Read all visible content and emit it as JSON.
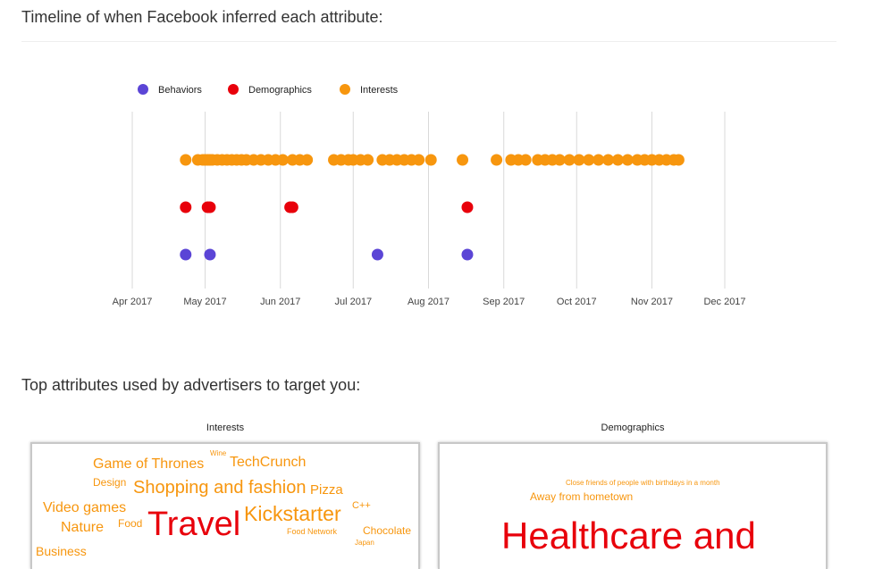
{
  "sections": {
    "timeline_title": "Timeline of when Facebook inferred each attribute:",
    "attributes_title": "Top attributes used by advertisers to target you:"
  },
  "colors": {
    "Behaviors": "#5b45d6",
    "Demographics": "#e8000b",
    "Interests": "#f7960e"
  },
  "chart_data": [
    {
      "type": "scatter",
      "xaxis": "date",
      "xlim": [
        "2017-03-14",
        "2017-12-24"
      ],
      "x_ticks": [
        "Apr 2017",
        "May 2017",
        "Jun 2017",
        "Jul 2017",
        "Aug 2017",
        "Sep 2017",
        "Oct 2017",
        "Nov 2017",
        "Dec 2017"
      ],
      "x_tick_dates": [
        "2017-04-01",
        "2017-05-01",
        "2017-06-01",
        "2017-07-01",
        "2017-08-01",
        "2017-09-01",
        "2017-10-01",
        "2017-11-01",
        "2017-12-01"
      ],
      "grid": "vertical",
      "legend_position": "top-left",
      "series": [
        {
          "name": "Behaviors",
          "dates": [
            "2017-04-23",
            "2017-05-03",
            "2017-07-11",
            "2017-08-17"
          ]
        },
        {
          "name": "Demographics",
          "dates": [
            "2017-04-23",
            "2017-05-02",
            "2017-05-03",
            "2017-06-05",
            "2017-06-06",
            "2017-08-17"
          ]
        },
        {
          "name": "Interests",
          "dates": [
            "2017-04-23",
            "2017-04-28",
            "2017-04-30",
            "2017-05-01",
            "2017-05-02",
            "2017-05-03",
            "2017-05-04",
            "2017-05-06",
            "2017-05-08",
            "2017-05-10",
            "2017-05-12",
            "2017-05-14",
            "2017-05-16",
            "2017-05-18",
            "2017-05-21",
            "2017-05-24",
            "2017-05-27",
            "2017-05-30",
            "2017-06-02",
            "2017-06-06",
            "2017-06-09",
            "2017-06-12",
            "2017-06-23",
            "2017-06-26",
            "2017-06-29",
            "2017-07-01",
            "2017-07-04",
            "2017-07-07",
            "2017-07-13",
            "2017-07-16",
            "2017-07-19",
            "2017-07-22",
            "2017-07-25",
            "2017-07-28",
            "2017-08-02",
            "2017-08-15",
            "2017-08-29",
            "2017-09-04",
            "2017-09-07",
            "2017-09-10",
            "2017-09-15",
            "2017-09-18",
            "2017-09-21",
            "2017-09-24",
            "2017-09-28",
            "2017-10-02",
            "2017-10-06",
            "2017-10-10",
            "2017-10-14",
            "2017-10-18",
            "2017-10-22",
            "2017-10-26",
            "2017-10-29",
            "2017-11-01",
            "2017-11-04",
            "2017-11-07",
            "2017-11-10",
            "2017-11-12"
          ]
        }
      ]
    }
  ],
  "word_clouds": [
    {
      "title": "Interests",
      "words": [
        {
          "text": "Game of Thrones",
          "color": "#f7960e"
        },
        {
          "text": "Wine",
          "color": "#f7960e"
        },
        {
          "text": "TechCrunch",
          "color": "#f7960e"
        },
        {
          "text": "Design",
          "color": "#f7960e"
        },
        {
          "text": "Shopping and fashion",
          "color": "#f7960e"
        },
        {
          "text": "Pizza",
          "color": "#f7960e"
        },
        {
          "text": "Video games",
          "color": "#f7960e"
        },
        {
          "text": "Kickstarter",
          "color": "#f7960e"
        },
        {
          "text": "C++",
          "color": "#f7960e"
        },
        {
          "text": "Nature",
          "color": "#f7960e"
        },
        {
          "text": "Food",
          "color": "#f7960e"
        },
        {
          "text": "Travel",
          "color": "#e8000b"
        },
        {
          "text": "Food Network",
          "color": "#f7960e"
        },
        {
          "text": "Chocolate",
          "color": "#f7960e"
        },
        {
          "text": "Japan",
          "color": "#f7960e"
        },
        {
          "text": "Business",
          "color": "#f7960e"
        }
      ]
    },
    {
      "title": "Demographics",
      "words": [
        {
          "text": "Close friends of people with birthdays in a month",
          "color": "#f7960e"
        },
        {
          "text": "Away from hometown",
          "color": "#f7960e"
        },
        {
          "text": "Healthcare and",
          "color": "#e8000b"
        }
      ]
    }
  ]
}
